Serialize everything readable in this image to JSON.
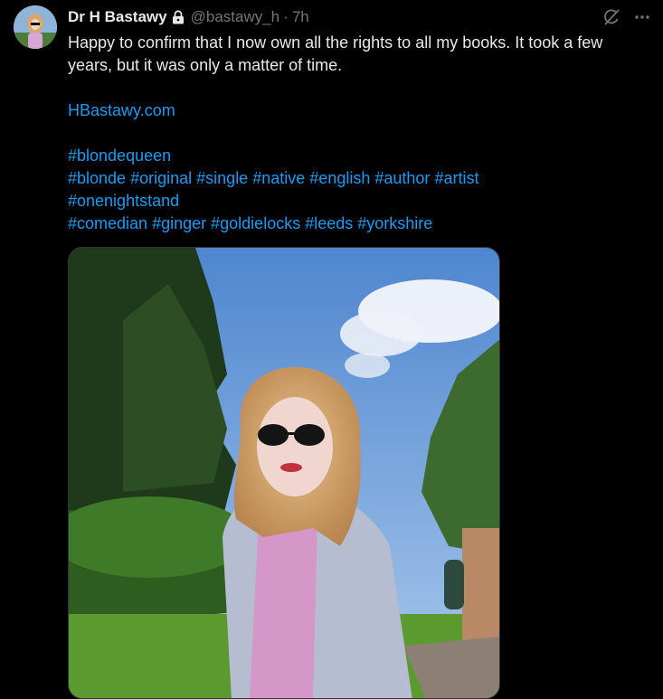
{
  "tweet": {
    "display_name": "Dr H Bastawy",
    "handle": "@bastawy_h",
    "separator": "·",
    "time": "7h",
    "text_line1": "Happy to confirm that I now own all the rights to all my books. It took a few",
    "text_line2": "years, but it was only a matter of time.",
    "website": "HBastawy.com",
    "hashtag_line1": [
      "#blondequeen"
    ],
    "hashtag_line2": [
      "#blonde",
      "#original",
      "#single",
      "#native",
      "#english",
      "#author",
      "#artist"
    ],
    "hashtag_line3": [
      "#onenightstand"
    ],
    "hashtag_line4": [
      "#comedian",
      "#ginger",
      "#goldielocks",
      "#leeds",
      "#yorkshire"
    ]
  },
  "icons": {
    "lock": "lock-icon",
    "grok": "grok-icon",
    "more": "more-icon"
  },
  "colors": {
    "background": "#000000",
    "text": "#e7e9ea",
    "secondary": "#71767b",
    "link": "#1d9bf0"
  }
}
